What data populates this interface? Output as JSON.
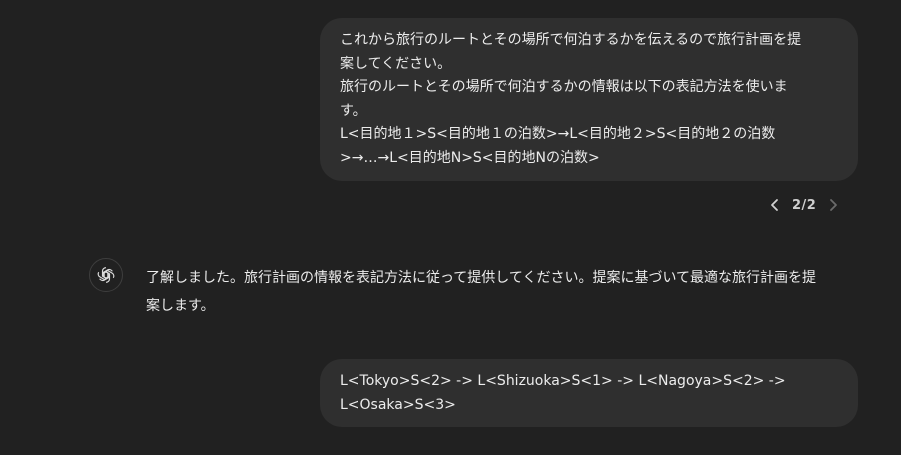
{
  "conversation": {
    "user_message_1": {
      "lines": [
        "これから旅行のルートとその場所で何泊するかを伝えるので旅行計画を提",
        "案してください。",
        "旅行のルートとその場所で何泊するかの情報は以下の表記方法を使いま",
        "す。",
        "L<目的地１>S<目的地１の泊数>→L<目的地２>S<目的地２の泊数",
        ">→…→L<目的地N>S<目的地Nの泊数>"
      ]
    },
    "pager": {
      "prev_icon": "chevron-left-icon",
      "count": "2/2",
      "next_icon": "chevron-right-icon"
    },
    "assistant_message": {
      "avatar_icon": "openai-logo-icon",
      "lines": [
        "了解しました。旅行計画の情報を表記方法に従って提供してください。提案に基づいて最適な旅行計画を提",
        "案します。"
      ]
    },
    "user_message_2": {
      "lines": [
        "L<Tokyo>S<2> -> L<Shizuoka>S<1> -> L<Nagoya>S<2> ->",
        "L<Osaka>S<3>"
      ]
    }
  },
  "colors": {
    "background": "#212121",
    "bubble": "#2f2f2f",
    "text": "#ececec",
    "muted": "#b4b4b4"
  }
}
